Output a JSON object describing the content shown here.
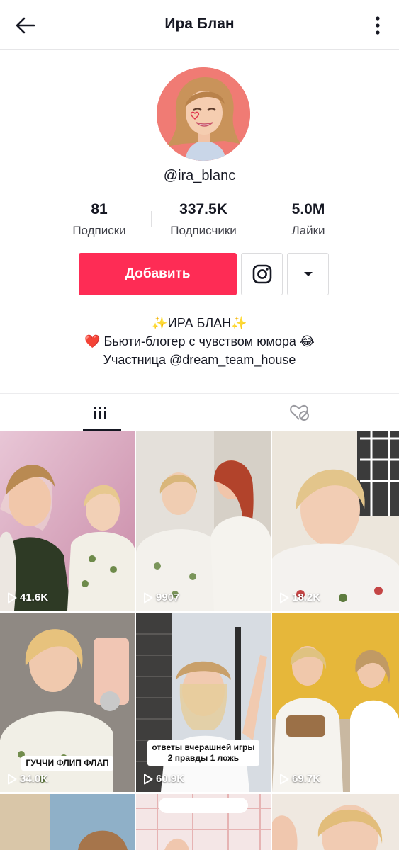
{
  "header": {
    "title": "Ира Блан",
    "back_icon": "arrow-left-icon",
    "more_icon": "vertical-ellipsis-icon"
  },
  "profile": {
    "handle": "@ira_blanc",
    "avatar_bg": "#f07b74"
  },
  "stats": [
    {
      "value": "81",
      "label": "Подписки"
    },
    {
      "value": "337.5K",
      "label": "Подписчики"
    },
    {
      "value": "5.0M",
      "label": "Лайки"
    }
  ],
  "actions": {
    "follow_label": "Добавить",
    "follow_color": "#fe2c55",
    "instagram_icon": "instagram-icon",
    "dropdown_icon": "caret-down-icon"
  },
  "bio": {
    "line1": "✨ИРА БЛАН✨",
    "line2": "❤️ Бьюти-блогер с чувством юмора 😂",
    "line3": "Участница @dream_team_house"
  },
  "tabs": [
    {
      "icon": "video-grid-icon",
      "active": true
    },
    {
      "icon": "liked-hidden-icon",
      "active": false
    }
  ],
  "videos": [
    {
      "views": "41.6K",
      "caption": ""
    },
    {
      "views": "9907",
      "caption": ""
    },
    {
      "views": "18.2K",
      "caption": ""
    },
    {
      "views": "34.0K",
      "caption": "ГУЧЧИ ФЛИП ФЛАП"
    },
    {
      "views": "60.9K",
      "caption": "ответы вчерашней игры\n2 правды 1 ложь"
    },
    {
      "views": "69.7K",
      "caption": ""
    }
  ]
}
